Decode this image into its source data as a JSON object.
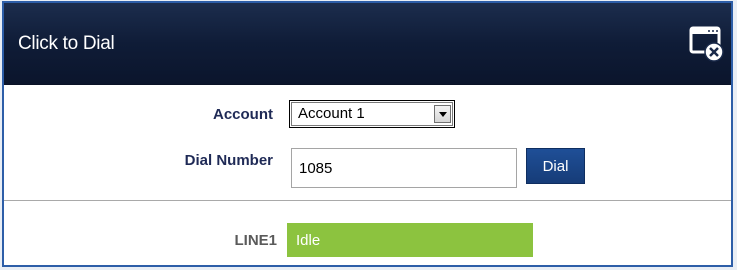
{
  "window": {
    "title": "Click to Dial",
    "close_icon": "close-window-icon"
  },
  "form": {
    "account_label": "Account",
    "account_selected": "Account 1",
    "dial_number_label": "Dial Number",
    "dial_number_value": "1085",
    "dial_button_label": "Dial"
  },
  "line": {
    "label": "LINE1",
    "status": "Idle",
    "status_color": "#8cc33f"
  },
  "colors": {
    "titlebar": "#0f1c37",
    "accent": "#1f4f97",
    "border": "#2d5ea8"
  }
}
